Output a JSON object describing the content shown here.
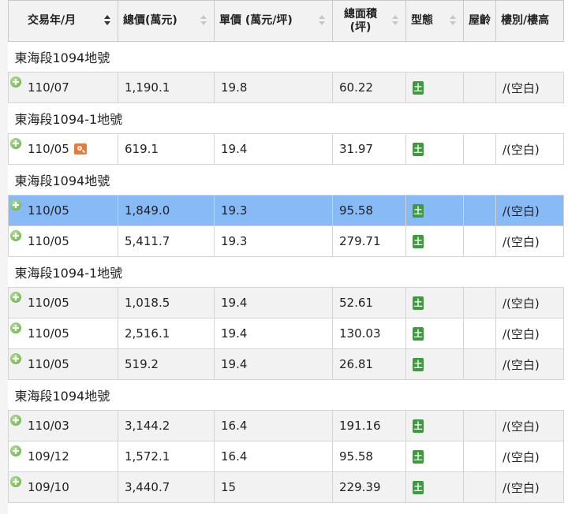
{
  "headers": {
    "date": "交易年/月",
    "total": "總價(萬元)",
    "unit": "單價 (萬元/坪)",
    "area_line1": "總面積",
    "area_line2": "(坪)",
    "type": "型態",
    "age": "屋齡",
    "floor": "樓別/樓高"
  },
  "land_label": "土",
  "groups": [
    {
      "title": "東海段1094地號",
      "rows": [
        {
          "date": "110/07",
          "total": "1,190.1",
          "unit": "19.8",
          "area": "60.22",
          "floor": "/(空白)"
        }
      ]
    },
    {
      "title": "東海段1094-1地號",
      "rows": [
        {
          "date": "110/05",
          "total": "619.1",
          "unit": "19.4",
          "area": "31.97",
          "floor": "/(空白)",
          "house": true
        }
      ]
    },
    {
      "title": "東海段1094地號",
      "rows": [
        {
          "date": "110/05",
          "total": "1,849.0",
          "unit": "19.3",
          "area": "95.58",
          "floor": "/(空白)",
          "selected": true
        },
        {
          "date": "110/05",
          "total": "5,411.7",
          "unit": "19.3",
          "area": "279.71",
          "floor": "/(空白)"
        }
      ]
    },
    {
      "title": "東海段1094-1地號",
      "rows": [
        {
          "date": "110/05",
          "total": "1,018.5",
          "unit": "19.4",
          "area": "52.61",
          "floor": "/(空白)"
        },
        {
          "date": "110/05",
          "total": "2,516.1",
          "unit": "19.4",
          "area": "130.03",
          "floor": "/(空白)"
        },
        {
          "date": "110/05",
          "total": "519.2",
          "unit": "19.4",
          "area": "26.81",
          "floor": "/(空白)"
        }
      ]
    },
    {
      "title": "東海段1094地號",
      "rows": [
        {
          "date": "110/03",
          "total": "3,144.2",
          "unit": "16.4",
          "area": "191.16",
          "floor": "/(空白)"
        },
        {
          "date": "109/12",
          "total": "1,572.1",
          "unit": "16.4",
          "area": "95.58",
          "floor": "/(空白)"
        },
        {
          "date": "109/10",
          "total": "3,440.7",
          "unit": "15",
          "area": "229.39",
          "floor": "/(空白)"
        }
      ]
    }
  ],
  "colors": {
    "selected": "#88bbf6",
    "alt": "#f2f2f2",
    "land_icon": "#3d9b3d",
    "expand_icon": "#5daa3a",
    "house_icon": "#e87a3a"
  }
}
